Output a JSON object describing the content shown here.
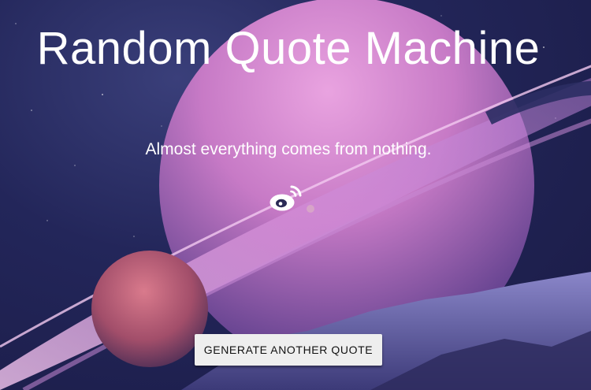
{
  "header": {
    "title": "Random Quote Machine"
  },
  "quote": {
    "text": "Almost everything comes from nothing."
  },
  "share": {
    "icon": "weibo-icon"
  },
  "actions": {
    "generate_label": "GENERATE ANOTHER QUOTE"
  },
  "colors": {
    "sky_dark": "#1a1b45",
    "planet_pink": "#d88ad0",
    "ring_pink": "#e6a6e6",
    "moon_red": "#a8506a",
    "button_bg": "#eeeeee"
  }
}
